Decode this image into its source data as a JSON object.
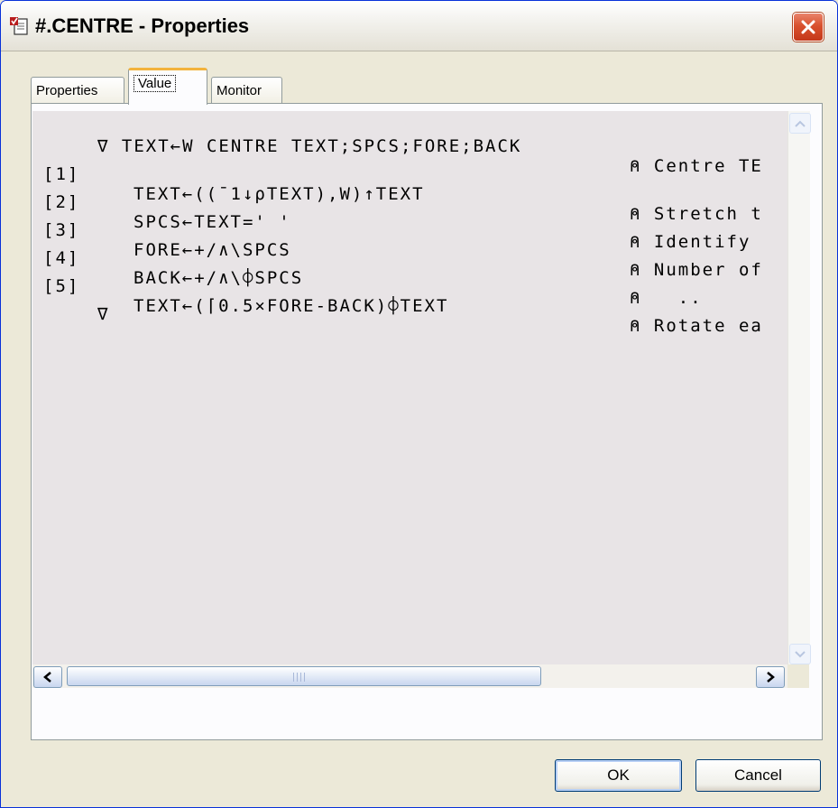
{
  "window": {
    "title": "#.CENTRE - Properties",
    "icon": "properties-doc-icon",
    "close_icon": "close-icon"
  },
  "tabs": [
    {
      "label": "Properties",
      "selected": false
    },
    {
      "label": "Value",
      "selected": true
    },
    {
      "label": "Monitor",
      "selected": false
    }
  ],
  "editor": {
    "header": {
      "code": "∇ TEXT←W CENTRE TEXT;SPCS;FORE;BACK",
      "comment": "⍝ Centre TE"
    },
    "lines": [
      {
        "num": "[1]",
        "code": "TEXT←((¯1↓⍴TEXT),W)↑TEXT",
        "comment": "⍝ Stretch t"
      },
      {
        "num": "[2]",
        "code": "SPCS←TEXT=' '",
        "comment": "⍝ Identify"
      },
      {
        "num": "[3]",
        "code": "FORE←+/∧\\SPCS",
        "comment": "⍝ Number of"
      },
      {
        "num": "[4]",
        "code": "BACK←+/∧\\⌽SPCS",
        "comment": "⍝   .."
      },
      {
        "num": "[5]",
        "code": "TEXT←(⌈0.5×FORE-BACK)⌽TEXT",
        "comment": "⍝ Rotate ea"
      }
    ],
    "footer": "∇"
  },
  "scrollbar": {
    "grip_icon": "grip-icon"
  },
  "buttons": {
    "ok": "OK",
    "cancel": "Cancel"
  },
  "colors": {
    "accent_tab": "#f3b33d",
    "close_button": "#d9512e",
    "editor_bg": "#e8e4e6"
  }
}
